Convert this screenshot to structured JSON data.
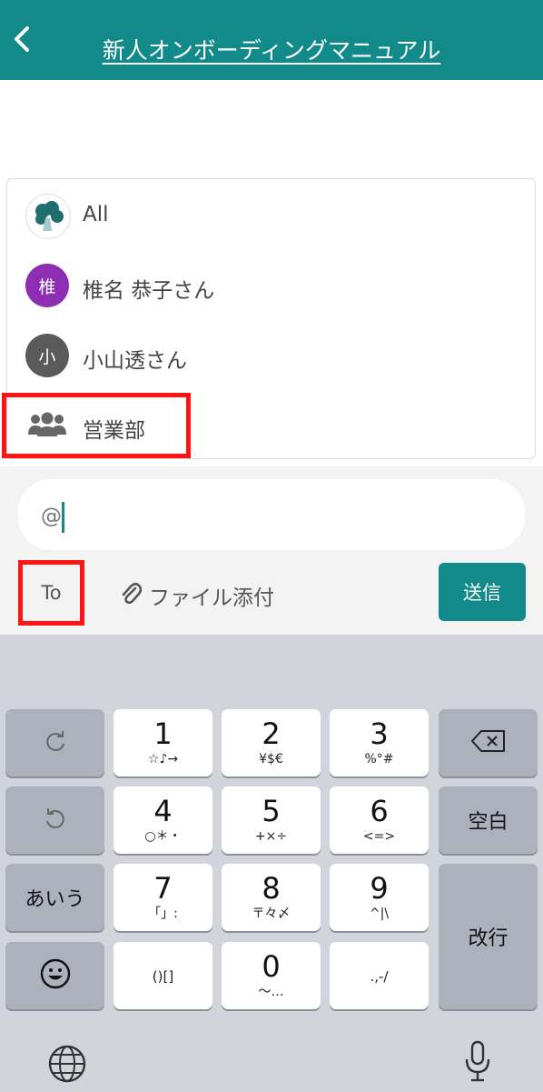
{
  "header": {
    "title": "新人オンボーディングマニュアル",
    "back_icon": "chevron-left-icon"
  },
  "mentions": [
    {
      "label": "All",
      "avatar_type": "logo",
      "avatar_icon": "broccoli-logo-icon"
    },
    {
      "label": "椎名 恭子さん",
      "avatar_type": "initial",
      "initial": "椎",
      "color": "#8e2fb3"
    },
    {
      "label": "小山透さん",
      "avatar_type": "initial",
      "initial": "小",
      "color": "#5a5a5a"
    },
    {
      "label": "営業部",
      "avatar_type": "icon",
      "avatar_icon": "group-icon"
    }
  ],
  "composer": {
    "input_value": "@",
    "to_label": "To",
    "attach_label": "ファイル添付",
    "attach_icon": "paperclip-icon",
    "send_label": "送信"
  },
  "keyboard": {
    "rows": [
      {
        "left": {
          "icon": "redo-icon"
        },
        "keys": [
          {
            "main": "1",
            "sub": "☆♪→"
          },
          {
            "main": "2",
            "sub": "¥$€"
          },
          {
            "main": "3",
            "sub": "%°#"
          }
        ],
        "right": {
          "icon": "delete-icon"
        }
      },
      {
        "left": {
          "icon": "undo-icon"
        },
        "keys": [
          {
            "main": "4",
            "sub": "○＊・"
          },
          {
            "main": "5",
            "sub": "+×÷"
          },
          {
            "main": "6",
            "sub": "<=>"
          }
        ],
        "right": {
          "label": "空白"
        }
      },
      {
        "left": {
          "label": "あいう"
        },
        "keys": [
          {
            "main": "7",
            "sub": "「」:"
          },
          {
            "main": "8",
            "sub": "〒々〆"
          },
          {
            "main": "9",
            "sub": "^|\\"
          }
        ],
        "right": {
          "label": "改行"
        }
      },
      {
        "left": {
          "icon": "emoji-icon"
        },
        "keys": [
          {
            "main": "",
            "sub": "()[]"
          },
          {
            "main": "0",
            "sub": "〜…"
          },
          {
            "main": "",
            "sub": ".,-/"
          }
        ]
      }
    ],
    "globe_icon": "globe-icon",
    "mic_icon": "microphone-icon"
  },
  "colors": {
    "accent": "#138a8a",
    "highlight": "#ff1515",
    "keyboard_bg": "#d1d4db"
  }
}
